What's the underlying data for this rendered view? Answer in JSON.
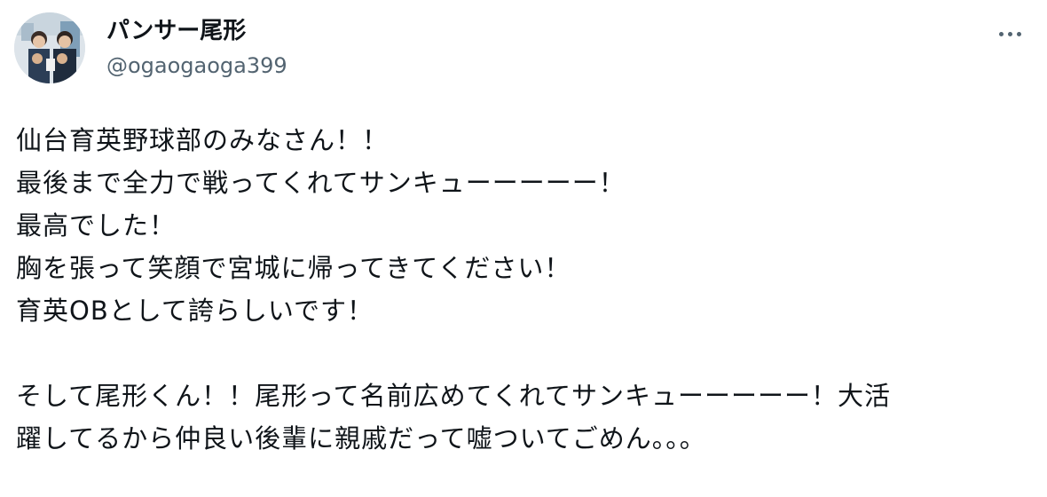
{
  "tweet": {
    "author": {
      "display_name": "パンサー尾形",
      "handle": "@ogaogaoga399"
    },
    "more_icon": "more-horizontal-icon",
    "text_lines": [
      "仙台育英野球部のみなさん！！",
      "最後まで全力で戦ってくれてサンキューーーーー！",
      "最高でした！",
      "胸を張って笑顔で宮城に帰ってきてください！",
      "育英OBとして誇らしいです！"
    ],
    "text_lines_2": [
      "そして尾形くん！！尾形って名前広めてくれてサンキューーーーー！大活",
      "躍してるから仲良い後輩に親戚だって嘘ついてごめん。。。"
    ]
  },
  "colors": {
    "text_primary": "#0f1419",
    "text_secondary": "#536471",
    "background": "#ffffff"
  }
}
